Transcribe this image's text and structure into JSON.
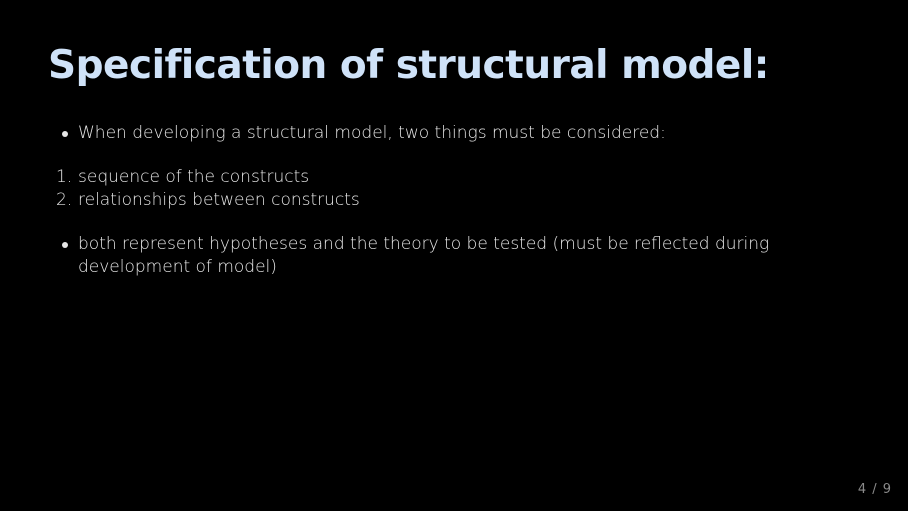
{
  "slide": {
    "title": "Specification of structural model:",
    "bullet_intro": "When developing a structural model, two things must be considered:",
    "numbered_items": [
      {
        "number": "1.",
        "text": "sequence of the constructs"
      },
      {
        "number": "2.",
        "text": "relationships between constructs"
      }
    ],
    "bullet_outro": "both represent hypotheses and the theory to be tested (must be reflected during development of model)",
    "page_number": "4 / 9"
  },
  "colors": {
    "background": "#000000",
    "title": "#cfe2f8",
    "body_text": "#e6e6e6",
    "page_number": "#8a8a8a"
  }
}
